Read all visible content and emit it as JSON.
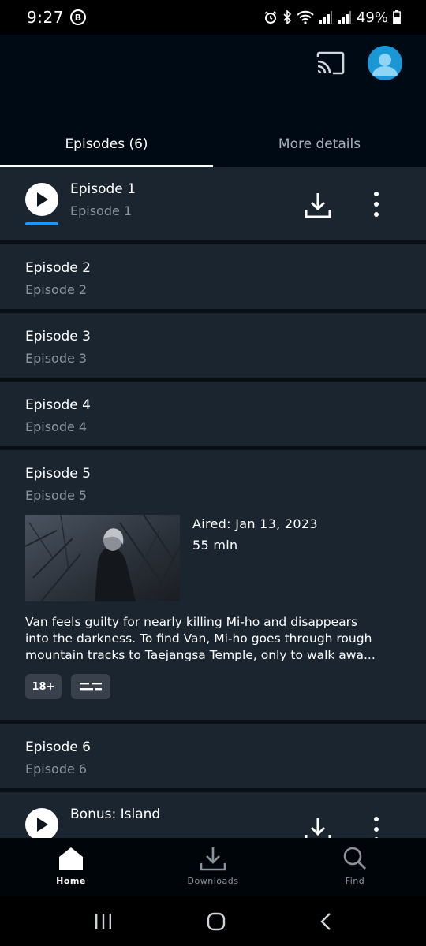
{
  "status_bar": {
    "time": "9:27",
    "b_badge": "B",
    "battery": "49%"
  },
  "tabs": [
    {
      "label": "Episodes (6)",
      "active": true
    },
    {
      "label": "More details",
      "active": false
    }
  ],
  "episodes": [
    {
      "title": "Episode 1",
      "subtitle": "Episode 1",
      "progress": 1.0
    },
    {
      "title": "Episode 2",
      "subtitle": "Episode 2"
    },
    {
      "title": "Episode 3",
      "subtitle": "Episode 3"
    },
    {
      "title": "Episode 4",
      "subtitle": "Episode 4"
    },
    {
      "title": "Episode 5",
      "subtitle": "Episode 5",
      "aired": "Aired: Jan 13, 2023",
      "duration": "55 min",
      "synopsis_lines": [
        "Van feels guilty for nearly killing Mi-ho and disappears",
        "into the darkness. To find Van, Mi-ho goes through rough",
        "mountain tracks to Taejangsa Temple, only to walk awa..."
      ],
      "rating": "18+",
      "subtitle_icon": "subtitles-icon"
    },
    {
      "title": "Episode 6",
      "subtitle": "Episode 6"
    },
    {
      "title": "Bonus: Island"
    }
  ],
  "bottom_nav": [
    {
      "label": "Home",
      "icon": "home-icon",
      "active": true
    },
    {
      "label": "Downloads",
      "icon": "download-icon",
      "active": false
    },
    {
      "label": "Find",
      "icon": "search-icon",
      "active": false
    }
  ],
  "colors": {
    "accent": "#1a98ff",
    "card": "#1b2530",
    "background": "#0f171e"
  }
}
